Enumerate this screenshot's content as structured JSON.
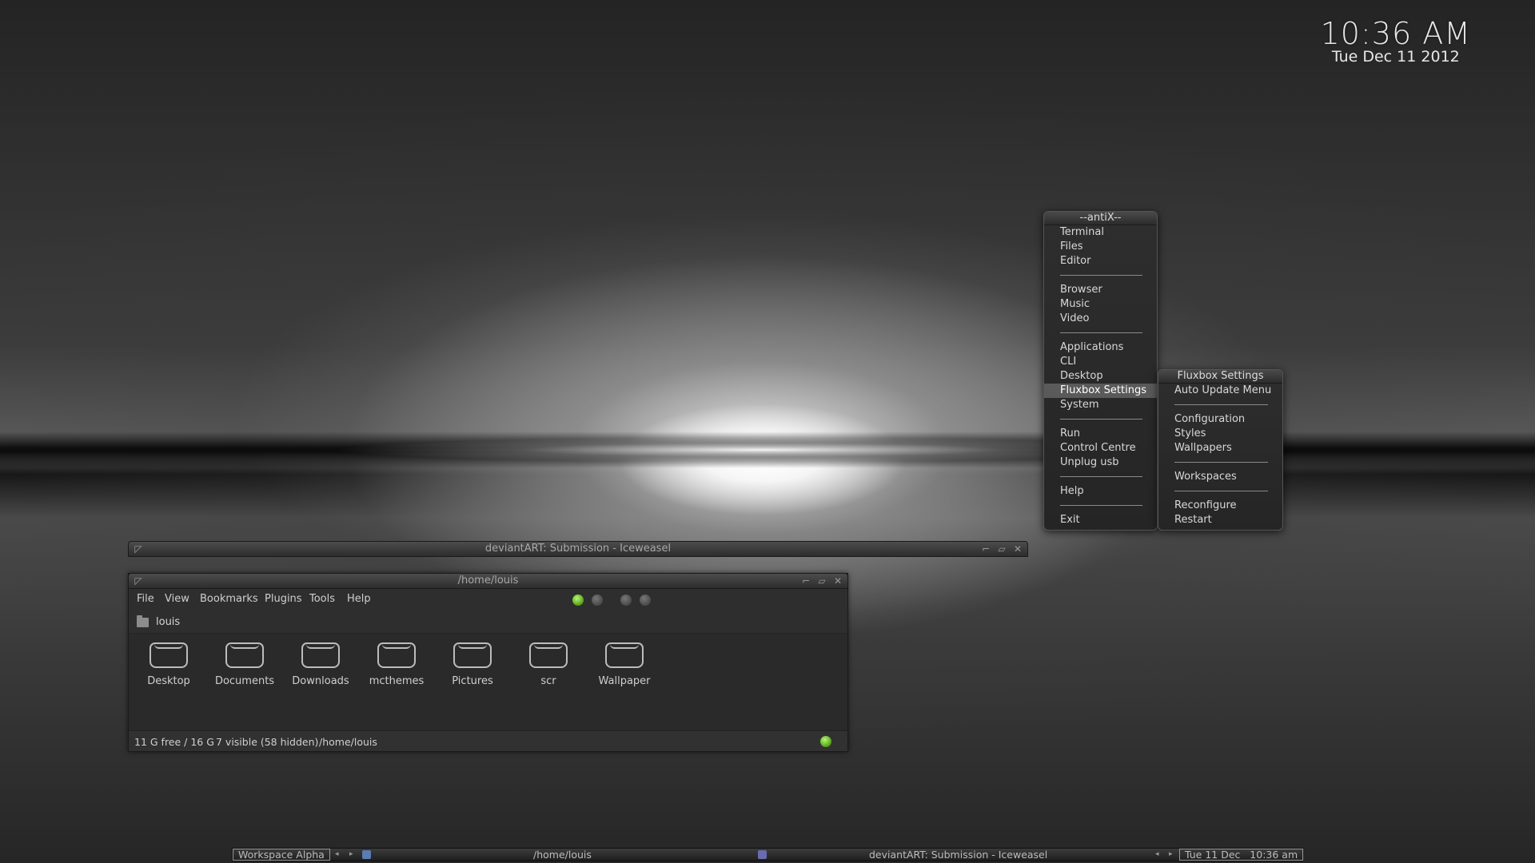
{
  "clock": {
    "time": "10:36 AM",
    "date": "Tue Dec 11 2012"
  },
  "main_menu": {
    "title": "--antiX--",
    "items": [
      {
        "label": "Terminal"
      },
      {
        "label": "Files"
      },
      {
        "label": "Editor"
      },
      {
        "sep": true
      },
      {
        "label": "Browser"
      },
      {
        "label": "Music"
      },
      {
        "label": "Video"
      },
      {
        "sep": true
      },
      {
        "label": "Applications"
      },
      {
        "label": "CLI"
      },
      {
        "label": "Desktop"
      },
      {
        "label": "Fluxbox Settings",
        "active": true
      },
      {
        "label": "System"
      },
      {
        "sep": true
      },
      {
        "label": "Run"
      },
      {
        "label": "Control Centre"
      },
      {
        "label": "Unplug usb"
      },
      {
        "sep": true
      },
      {
        "label": "Help"
      },
      {
        "sep": true
      },
      {
        "label": "Exit"
      }
    ]
  },
  "sub_menu": {
    "title": "Fluxbox Settings",
    "items": [
      {
        "label": "Auto Update Menu"
      },
      {
        "sep": true
      },
      {
        "label": "Configuration"
      },
      {
        "label": "Styles"
      },
      {
        "label": "Wallpapers"
      },
      {
        "sep": true
      },
      {
        "label": "Workspaces"
      },
      {
        "sep": true
      },
      {
        "label": "Reconfigure"
      },
      {
        "label": "Restart"
      }
    ]
  },
  "iceweasel_window": {
    "title": "deviantART: Submission - Iceweasel"
  },
  "file_manager": {
    "title": "/home/louis",
    "menubar": [
      "File",
      "View",
      "Bookmarks",
      "Plugins",
      "Tools",
      "Help"
    ],
    "breadcrumb": "louis",
    "folders": [
      "Desktop",
      "Documents",
      "Downloads",
      "mcthemes",
      "Pictures",
      "scr",
      "Wallpaper"
    ],
    "status": {
      "free": "11 G free / 16 G",
      "visible": "7 visible (58 hidden)",
      "path": "/home/louis"
    },
    "indicator_colors": {
      "active": "#5fae1e",
      "inactive": "#4a4a4a"
    }
  },
  "taskbar": {
    "workspace": "Workspace Alpha",
    "left_arrow": "◂",
    "right_arrow": "▸",
    "tasks": [
      "/home/louis",
      "deviantART: Submission - Iceweasel"
    ],
    "clock": "Tue 11 Dec   10:36 am"
  }
}
